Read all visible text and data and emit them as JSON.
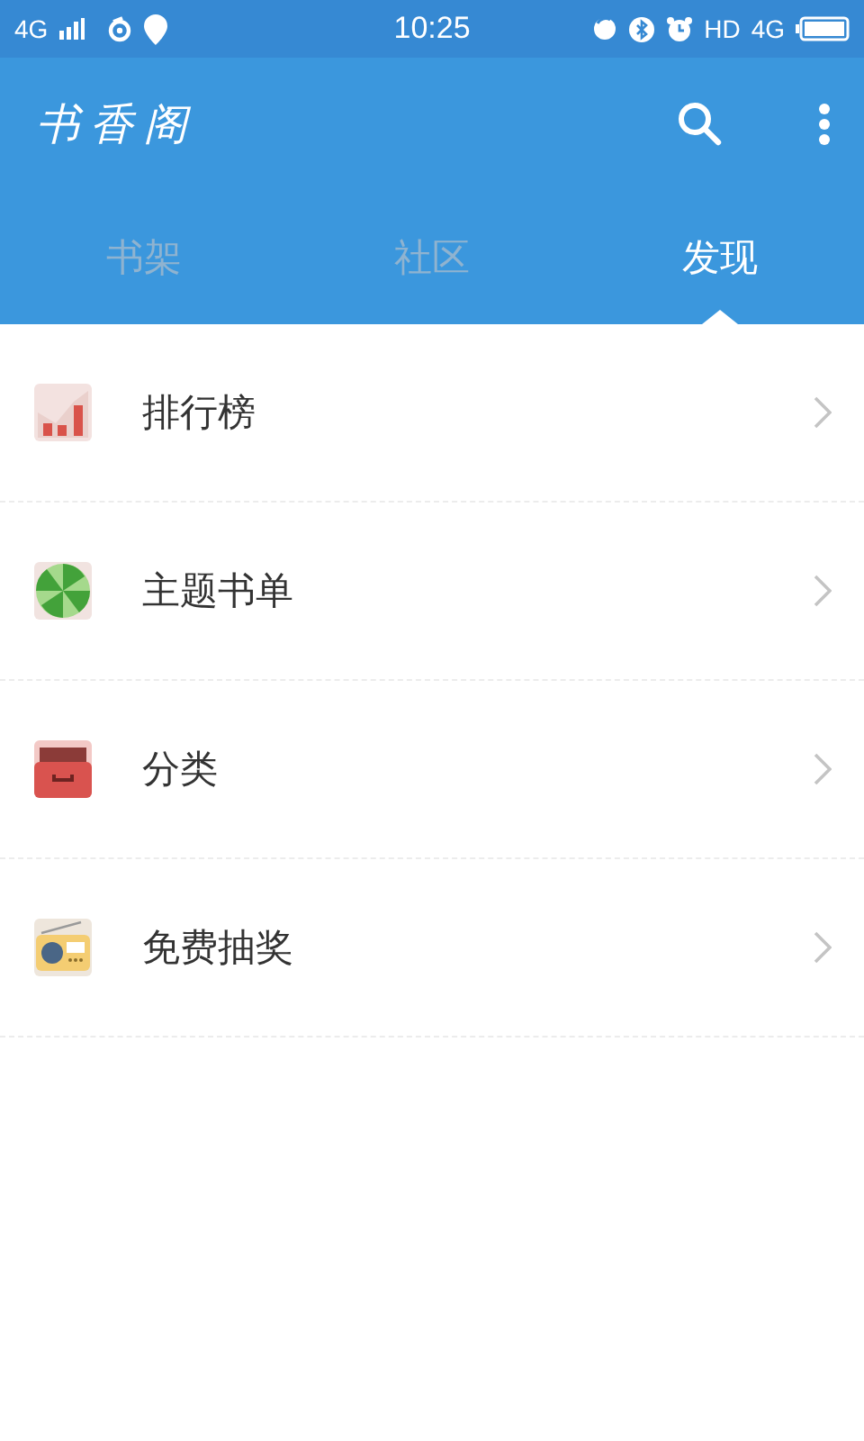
{
  "status_bar": {
    "network": "4G",
    "time": "10:25",
    "hd": "HD",
    "network_right": "4G"
  },
  "app_bar": {
    "title": "书香阁"
  },
  "tabs": [
    {
      "label": "书架",
      "selected": false
    },
    {
      "label": "社区",
      "selected": false
    },
    {
      "label": "发现",
      "selected": true
    }
  ],
  "items": [
    {
      "kind": "chart",
      "label": "排行榜"
    },
    {
      "kind": "candy",
      "label": "主题书单"
    },
    {
      "kind": "drawer",
      "label": "分类"
    },
    {
      "kind": "radio",
      "label": "免费抽奖"
    }
  ]
}
